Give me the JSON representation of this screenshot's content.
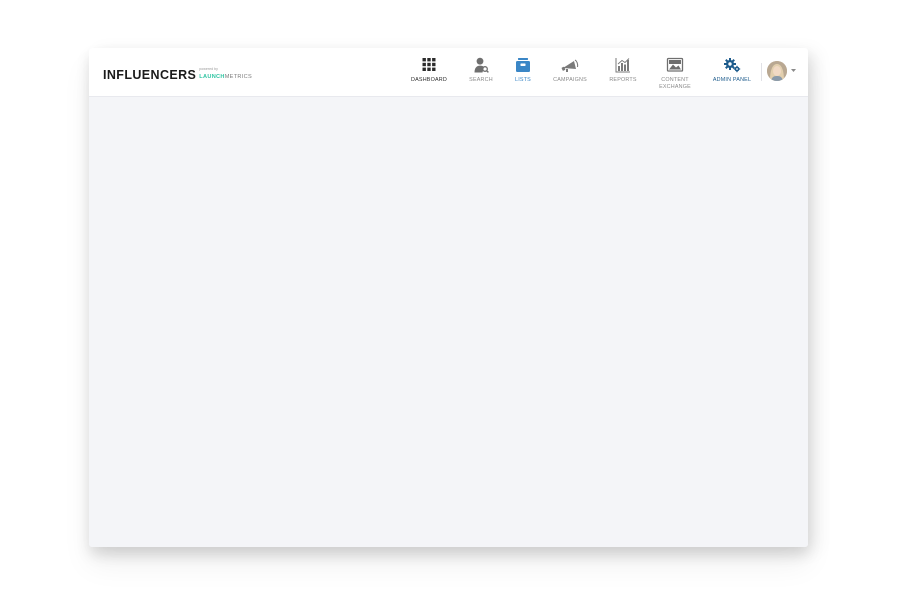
{
  "brand": {
    "name": "INFLUENCERS",
    "powered_by": "powered by",
    "company_part1": "LAUNCH",
    "company_part2": "METRICS"
  },
  "nav": [
    {
      "id": "dashboard",
      "label": "DASHBOARD",
      "icon": "grid-icon",
      "color": "#2b2b2b",
      "active": false
    },
    {
      "id": "search",
      "label": "SEARCH",
      "icon": "user-search-icon",
      "color": "#8a8a8a",
      "active": false
    },
    {
      "id": "lists",
      "label": "LISTS",
      "icon": "lists-icon",
      "color": "#3a86c6",
      "active": true
    },
    {
      "id": "campaigns",
      "label": "CAMPAIGNS",
      "icon": "megaphone-icon",
      "color": "#8a8a8a",
      "active": false
    },
    {
      "id": "reports",
      "label": "REPORTS",
      "icon": "bar-chart-icon",
      "color": "#8a8a8a",
      "active": false
    },
    {
      "id": "content_exchange",
      "label": "CONTENT\nEXCHANGE",
      "icon": "image-icon",
      "color": "#8a8a8a",
      "active": false
    },
    {
      "id": "admin_panel",
      "label": "ADMIN PANEL",
      "icon": "gears-icon",
      "color": "#1d5b8c",
      "active": false
    }
  ],
  "user_menu": {
    "avatar": "user-avatar",
    "icon": "caret-down-icon"
  },
  "colors": {
    "accent": "#3a86c6",
    "admin": "#1d5b8c",
    "brand_green": "#2ec4a1",
    "canvas": "#f4f5f8"
  }
}
